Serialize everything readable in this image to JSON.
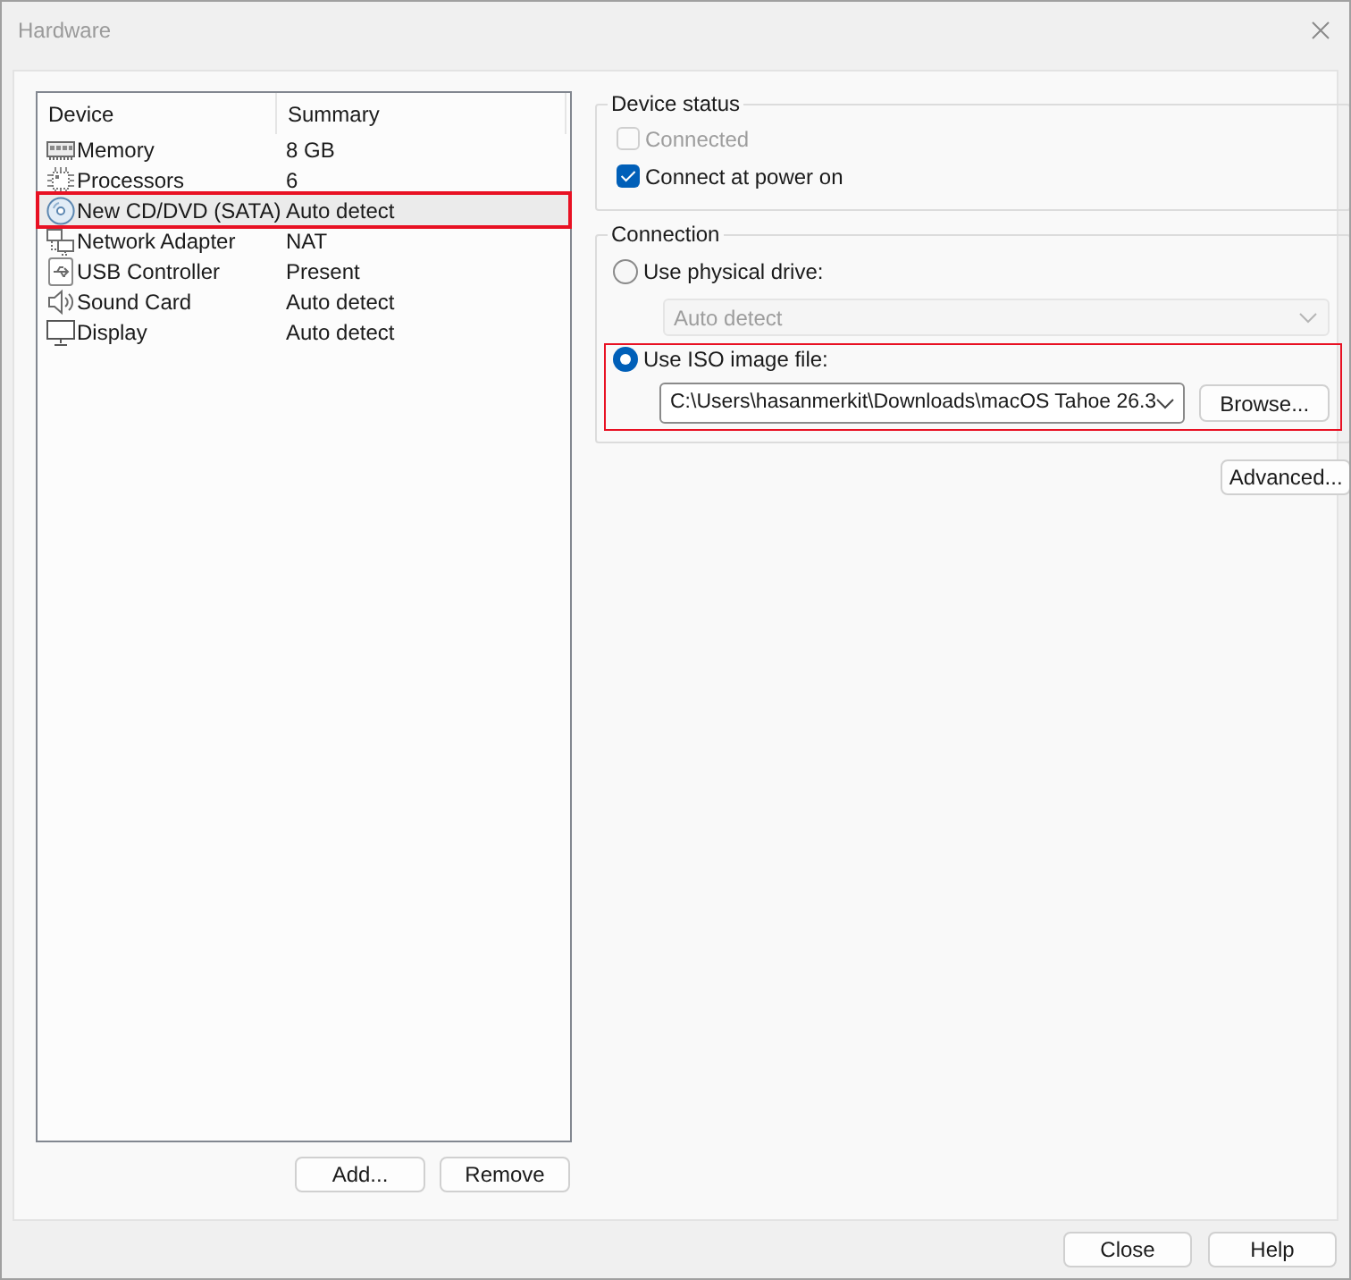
{
  "window": {
    "title": "Hardware"
  },
  "device_list": {
    "columns": [
      "Device",
      "Summary"
    ],
    "rows": [
      {
        "kind": "memory",
        "device": "Memory",
        "summary": "8 GB",
        "selected": false,
        "highlighted": false
      },
      {
        "kind": "processor",
        "device": "Processors",
        "summary": "6",
        "selected": false,
        "highlighted": false
      },
      {
        "kind": "cd",
        "device": "New CD/DVD (SATA)",
        "summary": "Auto detect",
        "selected": true,
        "highlighted": true
      },
      {
        "kind": "network",
        "device": "Network Adapter",
        "summary": "NAT",
        "selected": false,
        "highlighted": false
      },
      {
        "kind": "usb",
        "device": "USB Controller",
        "summary": "Present",
        "selected": false,
        "highlighted": false
      },
      {
        "kind": "sound",
        "device": "Sound Card",
        "summary": "Auto detect",
        "selected": false,
        "highlighted": false
      },
      {
        "kind": "display",
        "device": "Display",
        "summary": "Auto detect",
        "selected": false,
        "highlighted": false
      }
    ]
  },
  "list_buttons": [
    "Add...",
    "Remove"
  ],
  "device_status": {
    "title": "Device status",
    "checkboxes": [
      {
        "label": "Connected",
        "checked": false,
        "disabled": true
      },
      {
        "label": "Connect at power on",
        "checked": true,
        "disabled": false
      }
    ]
  },
  "connection": {
    "title": "Connection",
    "options": [
      {
        "kind": "drive",
        "label": "Use physical drive:",
        "selected": false,
        "highlighted": false,
        "dropdown": {
          "value": "Auto detect",
          "disabled": true
        }
      },
      {
        "kind": "iso",
        "label": "Use ISO image file:",
        "selected": true,
        "highlighted": true,
        "path": "C:\\Users\\hasanmerkit\\Downloads\\macOS Tahoe 26.3",
        "browse_button": "Browse..."
      }
    ]
  },
  "advanced_button": "Advanced...",
  "dialog_buttons": [
    "Close",
    "Help"
  ]
}
